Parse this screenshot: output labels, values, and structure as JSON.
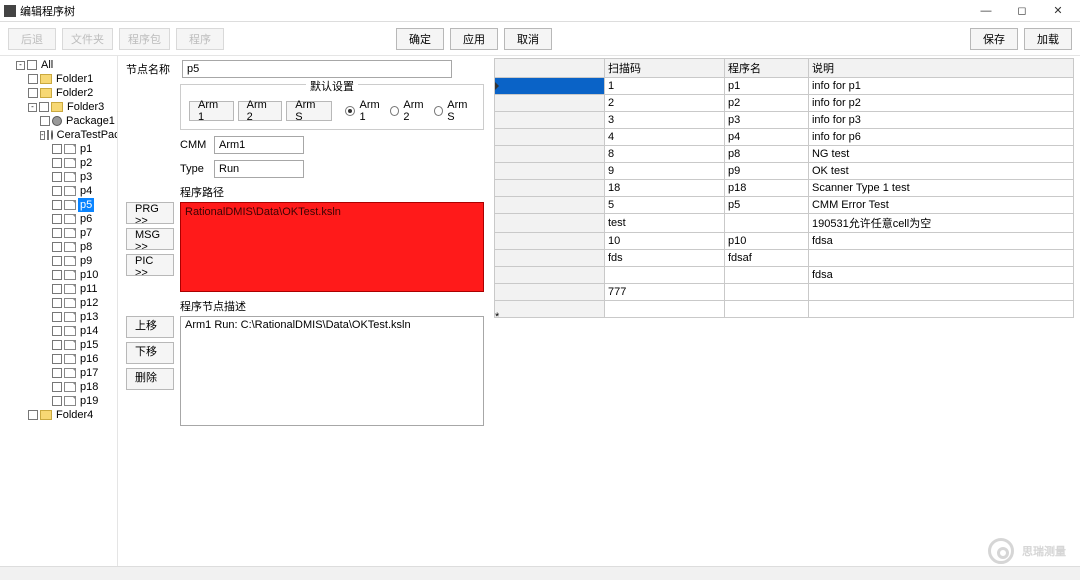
{
  "window": {
    "title": "编辑程序树"
  },
  "toolbar": {
    "back": "后退",
    "list": "文件夹",
    "pkgbtn": "程序包",
    "prg": "程序",
    "ok": "确定",
    "apply": "应用",
    "cancel": "取消",
    "save": "保存",
    "load": "加载"
  },
  "tree": {
    "root": "All",
    "folders": [
      "Folder1",
      "Folder2",
      "Folder3",
      "Folder4"
    ],
    "packages": [
      "Package1",
      "CeraTestPack"
    ],
    "programs": [
      "p1",
      "p2",
      "p3",
      "p4",
      "p5",
      "p6",
      "p7",
      "p8",
      "p9",
      "p10",
      "p11",
      "p12",
      "p13",
      "p14",
      "p15",
      "p16",
      "p17",
      "p18",
      "p19"
    ],
    "selected": "p5"
  },
  "form": {
    "nodeNameLabel": "节点名称",
    "nodeName": "p5",
    "defaultGroup": "默认设置",
    "arm1btn": "Arm 1",
    "arm2btn": "Arm 2",
    "armSbtn": "Arm S",
    "arm1radio": "Arm 1",
    "arm2radio": "Arm 2",
    "armSradio": "Arm S",
    "cmmLabel": "CMM",
    "cmm": "Arm1",
    "typeLabel": "Type",
    "type": "Run",
    "pathLabel": "程序路径",
    "prgBtn": "PRG >>",
    "msgBtn": "MSG >>",
    "picBtn": "PIC >>",
    "pathText": "RationalDMIS\\Data\\OKTest.ksln",
    "descLabel": "程序节点描述",
    "upBtn": "上移",
    "downBtn": "下移",
    "delBtn": "删除",
    "descText": "Arm1 Run: C:\\RationalDMIS\\Data\\OKTest.ksln"
  },
  "table": {
    "headers": [
      "扫描码",
      "程序名",
      "说明"
    ],
    "rows": [
      {
        "scan": "1",
        "prog": "p1",
        "desc": "info for p1",
        "sel": true
      },
      {
        "scan": "2",
        "prog": "p2",
        "desc": "info for p2"
      },
      {
        "scan": "3",
        "prog": "p3",
        "desc": "info for p3"
      },
      {
        "scan": "4",
        "prog": "p4",
        "desc": "info for p6"
      },
      {
        "scan": "8",
        "prog": "p8",
        "desc": "NG test"
      },
      {
        "scan": "9",
        "prog": "p9",
        "desc": "OK test"
      },
      {
        "scan": "18",
        "prog": "p18",
        "desc": "Scanner Type 1 test"
      },
      {
        "scan": "5",
        "prog": "p5",
        "desc": "CMM Error Test"
      },
      {
        "scan": "test",
        "prog": "",
        "desc": "190531允许任意cell为空"
      },
      {
        "scan": "10",
        "prog": "p10",
        "desc": "fdsa"
      },
      {
        "scan": "fds",
        "prog": "fdsaf",
        "desc": ""
      },
      {
        "scan": "",
        "prog": "",
        "desc": "fdsa"
      },
      {
        "scan": "777",
        "prog": "",
        "desc": ""
      }
    ]
  },
  "watermark": "思瑞测量"
}
